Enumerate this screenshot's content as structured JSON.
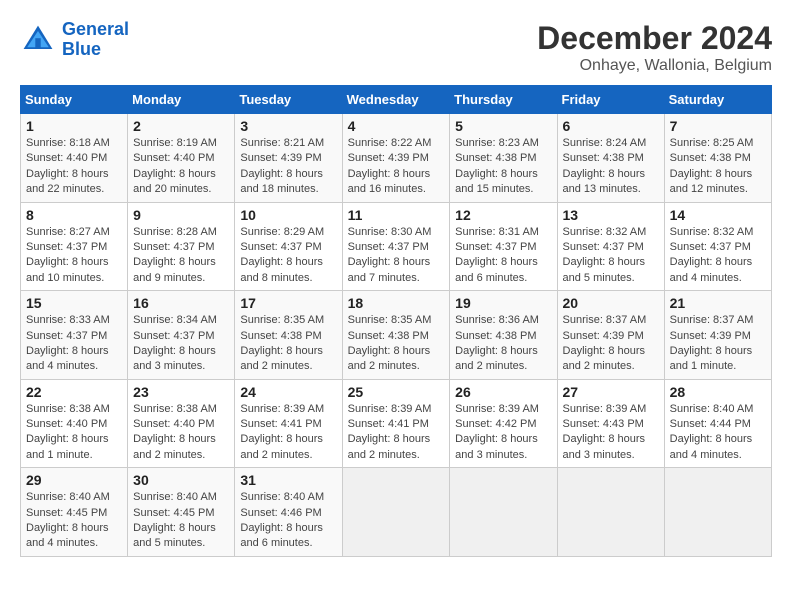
{
  "logo": {
    "line1": "General",
    "line2": "Blue"
  },
  "title": "December 2024",
  "subtitle": "Onhaye, Wallonia, Belgium",
  "days_of_week": [
    "Sunday",
    "Monday",
    "Tuesday",
    "Wednesday",
    "Thursday",
    "Friday",
    "Saturday"
  ],
  "weeks": [
    [
      {
        "day": "1",
        "sunrise": "8:18 AM",
        "sunset": "4:40 PM",
        "daylight": "8 hours and 22 minutes."
      },
      {
        "day": "2",
        "sunrise": "8:19 AM",
        "sunset": "4:40 PM",
        "daylight": "8 hours and 20 minutes."
      },
      {
        "day": "3",
        "sunrise": "8:21 AM",
        "sunset": "4:39 PM",
        "daylight": "8 hours and 18 minutes."
      },
      {
        "day": "4",
        "sunrise": "8:22 AM",
        "sunset": "4:39 PM",
        "daylight": "8 hours and 16 minutes."
      },
      {
        "day": "5",
        "sunrise": "8:23 AM",
        "sunset": "4:38 PM",
        "daylight": "8 hours and 15 minutes."
      },
      {
        "day": "6",
        "sunrise": "8:24 AM",
        "sunset": "4:38 PM",
        "daylight": "8 hours and 13 minutes."
      },
      {
        "day": "7",
        "sunrise": "8:25 AM",
        "sunset": "4:38 PM",
        "daylight": "8 hours and 12 minutes."
      }
    ],
    [
      {
        "day": "8",
        "sunrise": "8:27 AM",
        "sunset": "4:37 PM",
        "daylight": "8 hours and 10 minutes."
      },
      {
        "day": "9",
        "sunrise": "8:28 AM",
        "sunset": "4:37 PM",
        "daylight": "8 hours and 9 minutes."
      },
      {
        "day": "10",
        "sunrise": "8:29 AM",
        "sunset": "4:37 PM",
        "daylight": "8 hours and 8 minutes."
      },
      {
        "day": "11",
        "sunrise": "8:30 AM",
        "sunset": "4:37 PM",
        "daylight": "8 hours and 7 minutes."
      },
      {
        "day": "12",
        "sunrise": "8:31 AM",
        "sunset": "4:37 PM",
        "daylight": "8 hours and 6 minutes."
      },
      {
        "day": "13",
        "sunrise": "8:32 AM",
        "sunset": "4:37 PM",
        "daylight": "8 hours and 5 minutes."
      },
      {
        "day": "14",
        "sunrise": "8:32 AM",
        "sunset": "4:37 PM",
        "daylight": "8 hours and 4 minutes."
      }
    ],
    [
      {
        "day": "15",
        "sunrise": "8:33 AM",
        "sunset": "4:37 PM",
        "daylight": "8 hours and 4 minutes."
      },
      {
        "day": "16",
        "sunrise": "8:34 AM",
        "sunset": "4:37 PM",
        "daylight": "8 hours and 3 minutes."
      },
      {
        "day": "17",
        "sunrise": "8:35 AM",
        "sunset": "4:38 PM",
        "daylight": "8 hours and 2 minutes."
      },
      {
        "day": "18",
        "sunrise": "8:35 AM",
        "sunset": "4:38 PM",
        "daylight": "8 hours and 2 minutes."
      },
      {
        "day": "19",
        "sunrise": "8:36 AM",
        "sunset": "4:38 PM",
        "daylight": "8 hours and 2 minutes."
      },
      {
        "day": "20",
        "sunrise": "8:37 AM",
        "sunset": "4:39 PM",
        "daylight": "8 hours and 2 minutes."
      },
      {
        "day": "21",
        "sunrise": "8:37 AM",
        "sunset": "4:39 PM",
        "daylight": "8 hours and 1 minute."
      }
    ],
    [
      {
        "day": "22",
        "sunrise": "8:38 AM",
        "sunset": "4:40 PM",
        "daylight": "8 hours and 1 minute."
      },
      {
        "day": "23",
        "sunrise": "8:38 AM",
        "sunset": "4:40 PM",
        "daylight": "8 hours and 2 minutes."
      },
      {
        "day": "24",
        "sunrise": "8:39 AM",
        "sunset": "4:41 PM",
        "daylight": "8 hours and 2 minutes."
      },
      {
        "day": "25",
        "sunrise": "8:39 AM",
        "sunset": "4:41 PM",
        "daylight": "8 hours and 2 minutes."
      },
      {
        "day": "26",
        "sunrise": "8:39 AM",
        "sunset": "4:42 PM",
        "daylight": "8 hours and 3 minutes."
      },
      {
        "day": "27",
        "sunrise": "8:39 AM",
        "sunset": "4:43 PM",
        "daylight": "8 hours and 3 minutes."
      },
      {
        "day": "28",
        "sunrise": "8:40 AM",
        "sunset": "4:44 PM",
        "daylight": "8 hours and 4 minutes."
      }
    ],
    [
      {
        "day": "29",
        "sunrise": "8:40 AM",
        "sunset": "4:45 PM",
        "daylight": "8 hours and 4 minutes."
      },
      {
        "day": "30",
        "sunrise": "8:40 AM",
        "sunset": "4:45 PM",
        "daylight": "8 hours and 5 minutes."
      },
      {
        "day": "31",
        "sunrise": "8:40 AM",
        "sunset": "4:46 PM",
        "daylight": "8 hours and 6 minutes."
      },
      null,
      null,
      null,
      null
    ]
  ],
  "labels": {
    "sunrise": "Sunrise: ",
    "sunset": "Sunset: ",
    "daylight": "Daylight: "
  }
}
